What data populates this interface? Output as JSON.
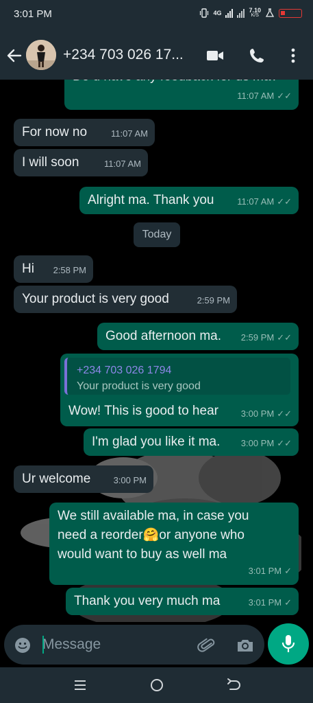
{
  "status_bar": {
    "time": "3:01 PM",
    "network": "4G",
    "speed": "7.10",
    "speed_unit": "K/S"
  },
  "header": {
    "contact_name": "+234 703 026 17...",
    "icons": [
      "back-arrow-icon",
      "video-call-icon",
      "phone-icon",
      "more-vertical-icon"
    ]
  },
  "messages": [
    {
      "dir": "out",
      "text": "Do u have any feedback for us ma?",
      "time": "11:07 AM",
      "status": "read"
    },
    {
      "dir": "in",
      "text": "For now no",
      "time": "11:07 AM"
    },
    {
      "dir": "in",
      "text": "I will soon",
      "time": "11:07 AM"
    },
    {
      "dir": "out",
      "text": "Alright ma. Thank you",
      "time": "11:07 AM",
      "status": "read"
    },
    {
      "dir": "in",
      "text": "Hi",
      "time": "2:58 PM"
    },
    {
      "dir": "in",
      "text": "Your product is very good",
      "time": "2:59 PM"
    },
    {
      "dir": "out",
      "text": "Good afternoon ma.",
      "time": "2:59 PM",
      "status": "read"
    },
    {
      "dir": "out",
      "text": "Wow! This is good to hear",
      "time": "3:00 PM",
      "status": "read",
      "quote": {
        "sender": "+234 703 026 1794",
        "text": "Your product is very good"
      }
    },
    {
      "dir": "out",
      "text": "I'm glad you like it ma.",
      "time": "3:00 PM",
      "status": "read"
    },
    {
      "dir": "in",
      "text": "Ur welcome",
      "time": "3:00 PM"
    },
    {
      "dir": "out",
      "lines": [
        "We still available ma, in case you",
        "need a reorder🤗or anyone who",
        "would want to buy as well ma"
      ],
      "time": "3:01 PM",
      "status": "sent"
    },
    {
      "dir": "out",
      "text": "Thank you very much ma",
      "time": "3:01 PM",
      "status": "sent"
    }
  ],
  "date_divider": "Today",
  "composer": {
    "placeholder": "Message",
    "icons": [
      "emoji-icon",
      "attachment-icon",
      "camera-icon",
      "microphone-icon"
    ]
  },
  "nav_bar": {
    "icons": [
      "recent-apps-icon",
      "home-icon",
      "back-icon"
    ]
  },
  "colors": {
    "header_bg": "#1f2c34",
    "incoming_bubble": "#222e35",
    "outgoing_bubble": "#005c4b",
    "accent": "#00a884",
    "quote_bar": "#7a71d8"
  }
}
